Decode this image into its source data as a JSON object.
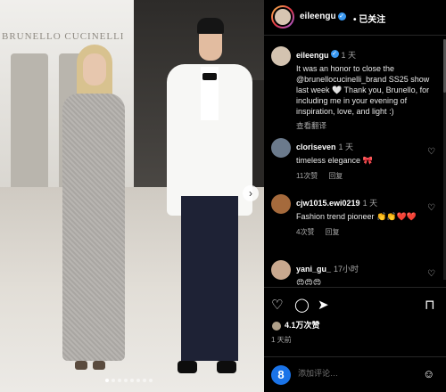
{
  "header": {
    "username": "eileengu",
    "separator": "•",
    "follow_label": "已关注"
  },
  "caption": {
    "username": "eileengu",
    "time": "1 天",
    "text": "It was an honor to close the @brunellocucinelli_brand SS25 show last week 🤍 Thank you, Brunello, for including me in your evening of inspiration, love, and light :)",
    "translate_label": "查看翻译"
  },
  "comments": [
    {
      "username": "cloriseven",
      "time": "1 天",
      "text": "timeless elegance 🎀",
      "likes": "11次赞",
      "reply_label": "回复"
    },
    {
      "username": "cjw1015.ewi0219",
      "time": "1 天",
      "text": "Fashion trend pioneer 👏👏❤️❤️",
      "likes": "4次赞",
      "reply_label": "回复"
    },
    {
      "username": "yani_gu_",
      "time": "17小时",
      "text": "😍😍😍"
    }
  ],
  "actions": {
    "likes": "4.1万次赞",
    "date": "1 天前"
  },
  "add_comment": {
    "avatar_letter": "8",
    "placeholder": "添加评论…"
  },
  "media": {
    "brand_text": "BRUNELLO CUCINELLI",
    "dot_count": 8,
    "active_dot": 0
  },
  "icons": {
    "like": "heart-icon",
    "comment": "comment-icon",
    "share": "send-icon",
    "save": "bookmark-icon",
    "emoji": "emoji-icon"
  },
  "colors": {
    "panel_bg": "#000000",
    "verified": "#3897f0",
    "muted": "#a8a8a8"
  }
}
